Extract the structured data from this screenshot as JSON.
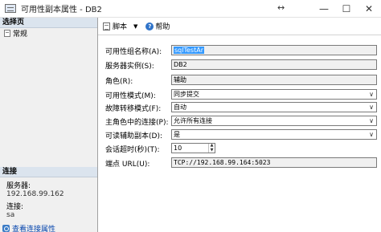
{
  "window": {
    "title": "可用性副本属性 - DB2",
    "minimize_glyph": "—",
    "maximize_glyph": "☐",
    "close_glyph": "✕",
    "resize_glyph": "↔"
  },
  "left_pane": {
    "select_page_header": "选择页",
    "pages": [
      {
        "label": "常规",
        "icon": "page-icon"
      }
    ],
    "connection_header": "连接",
    "server_label": "服务器:",
    "server_value": "192.168.99.162",
    "connection_label": "连接:",
    "connection_value": "sa",
    "view_connection_link": "查看连接属性"
  },
  "toolbar": {
    "script_label": "脚本",
    "script_dropdown_glyph": "▼",
    "help_label": "帮助",
    "help_icon_glyph": "?"
  },
  "form": {
    "group_name_label": "可用性组名称(A):",
    "group_name_value": "sqlTestAr",
    "server_instance_label": "服务器实例(S):",
    "server_instance_value": "DB2",
    "role_label": "角色(R):",
    "role_value": "辅助",
    "availability_mode_label": "可用性模式(M):",
    "availability_mode_value": "同步提交",
    "failover_mode_label": "故障转移模式(F):",
    "failover_mode_value": "自动",
    "primary_connections_label": "主角色中的连接(P):",
    "primary_connections_value": "允许所有连接",
    "readable_secondary_label": "可读辅助副本(D):",
    "readable_secondary_value": "是",
    "session_timeout_label": "会话超时(秒)(T):",
    "session_timeout_value": "10",
    "endpoint_url_label": "端点 URL(U):",
    "endpoint_url_value": "TCP://192.168.99.164:5023",
    "dropdown_glyph": "∨",
    "spin_up_glyph": "▲",
    "spin_down_glyph": "▼"
  },
  "colors": {
    "section_header_bg": "#dbe4ee",
    "selection": "#3399ff",
    "link": "#0645ad"
  }
}
